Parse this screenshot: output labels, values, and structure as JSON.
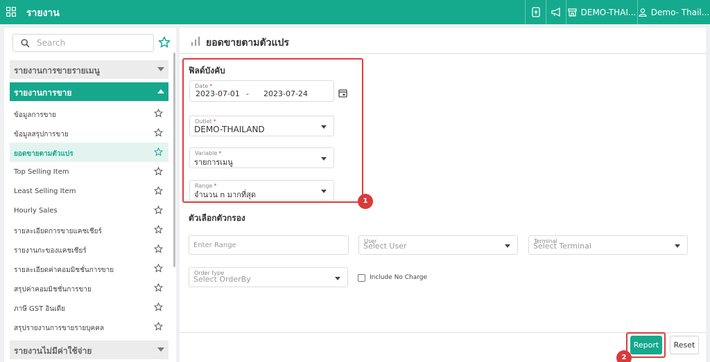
{
  "header": {
    "app_title": "รายงาน",
    "outlet_label": "DEMO-THAI...",
    "user_label": "Demo- Thail..."
  },
  "sidebar": {
    "search_placeholder": "Search",
    "groups": [
      {
        "label": "รายงานการขายรายเมนู",
        "expanded": false
      },
      {
        "label": "รายงานการขาย",
        "expanded": true
      },
      {
        "label": "รายงานไม่มีค่าใช้จ่าย",
        "expanded": false
      }
    ],
    "items": [
      {
        "label": "ข้อมูลการขาย"
      },
      {
        "label": "ข้อมูลสรุปการขาย"
      },
      {
        "label": "ยอดขายตามตัวแปร",
        "selected": true
      },
      {
        "label": "Top Selling Item"
      },
      {
        "label": "Least Selling Item"
      },
      {
        "label": "Hourly Sales"
      },
      {
        "label": "รายละเอียดการขายแคชเชียร์"
      },
      {
        "label": "รายงานกะของแคชเชียร์"
      },
      {
        "label": "รายละเอียดค่าคอมมิชชั่นการขาย"
      },
      {
        "label": "สรุปค่าคอมมิชชั่นการขาย"
      },
      {
        "label": "ภาษี GST อินเดีย"
      },
      {
        "label": "สรุปรายงานการขายรายบุคคล"
      }
    ]
  },
  "main": {
    "page_title": "ยอดขายตามตัวแปร",
    "required_section_title": "ฟิลด์บังคับ",
    "filter_section_title": "ตัวเลือกตัวกรอง",
    "date": {
      "label": "Date",
      "start": "2023-07-01",
      "separator": "-",
      "end": "2023-07-24"
    },
    "outlet": {
      "label": "Outlet",
      "value": "DEMO-THAILAND"
    },
    "variable": {
      "label": "Variable",
      "value": "รายการเมนู"
    },
    "range": {
      "label": "Range",
      "value": "จำนวน n มากที่สุด"
    },
    "required_marker": "*",
    "enter_range_placeholder": "Enter Range",
    "user": {
      "label": "User",
      "placeholder": "Select User"
    },
    "terminal": {
      "label": "Terminal",
      "placeholder": "Select Terminal"
    },
    "order_type": {
      "label": "Order type",
      "placeholder": "Select OrderBy"
    },
    "include_no_charge_label": "Include No Charge",
    "report_button": "Report",
    "reset_button": "Reset"
  },
  "annotations": {
    "callout_1": "1",
    "callout_2": "2"
  },
  "colors": {
    "brand": "#15aa8e",
    "highlight": "#e03b3b"
  }
}
